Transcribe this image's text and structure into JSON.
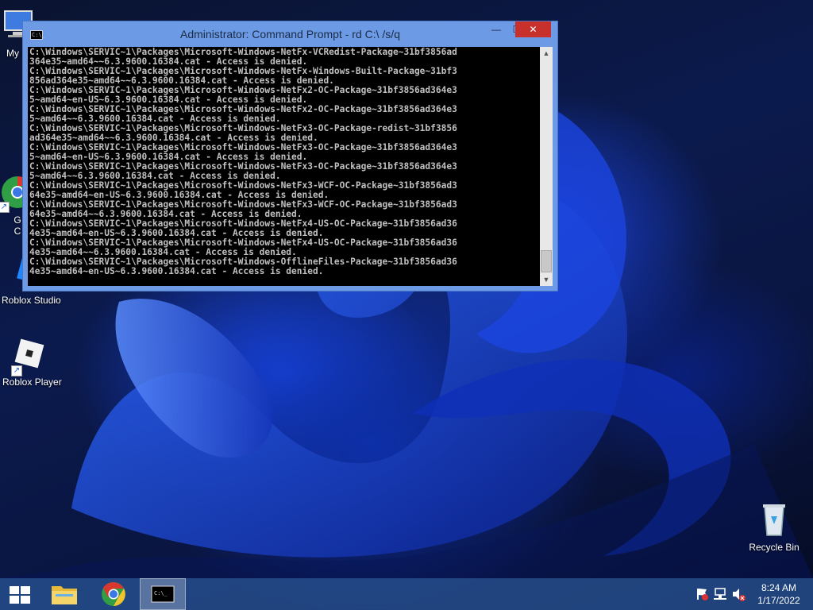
{
  "desktop": {
    "icons": [
      {
        "label": "My C"
      },
      {
        "label": "G"
      },
      {
        "label": "C"
      },
      {
        "label": "Roblox Studio"
      },
      {
        "label": "Roblox Player"
      },
      {
        "label": "Recycle Bin"
      }
    ]
  },
  "window": {
    "title": "Administrator: Command Prompt - rd  C:\\ /s/q",
    "icon": "cmd-icon",
    "controls": {
      "minimize": "—",
      "maximize": "☐",
      "close": "✕"
    },
    "console_output": "C:\\Windows\\SERVIC~1\\Packages\\Microsoft-Windows-NetFx-VCRedist-Package~31bf3856ad\n364e35~amd64~~6.3.9600.16384.cat - Access is denied.\nC:\\Windows\\SERVIC~1\\Packages\\Microsoft-Windows-NetFx-Windows-Built-Package~31bf3\n856ad364e35~amd64~~6.3.9600.16384.cat - Access is denied.\nC:\\Windows\\SERVIC~1\\Packages\\Microsoft-Windows-NetFx2-OC-Package~31bf3856ad364e3\n5~amd64~en-US~6.3.9600.16384.cat - Access is denied.\nC:\\Windows\\SERVIC~1\\Packages\\Microsoft-Windows-NetFx2-OC-Package~31bf3856ad364e3\n5~amd64~~6.3.9600.16384.cat - Access is denied.\nC:\\Windows\\SERVIC~1\\Packages\\Microsoft-Windows-NetFx3-OC-Package-redist~31bf3856\nad364e35~amd64~~6.3.9600.16384.cat - Access is denied.\nC:\\Windows\\SERVIC~1\\Packages\\Microsoft-Windows-NetFx3-OC-Package~31bf3856ad364e3\n5~amd64~en-US~6.3.9600.16384.cat - Access is denied.\nC:\\Windows\\SERVIC~1\\Packages\\Microsoft-Windows-NetFx3-OC-Package~31bf3856ad364e3\n5~amd64~~6.3.9600.16384.cat - Access is denied.\nC:\\Windows\\SERVIC~1\\Packages\\Microsoft-Windows-NetFx3-WCF-OC-Package~31bf3856ad3\n64e35~amd64~en-US~6.3.9600.16384.cat - Access is denied.\nC:\\Windows\\SERVIC~1\\Packages\\Microsoft-Windows-NetFx3-WCF-OC-Package~31bf3856ad3\n64e35~amd64~~6.3.9600.16384.cat - Access is denied.\nC:\\Windows\\SERVIC~1\\Packages\\Microsoft-Windows-NetFx4-US-OC-Package~31bf3856ad36\n4e35~amd64~en-US~6.3.9600.16384.cat - Access is denied.\nC:\\Windows\\SERVIC~1\\Packages\\Microsoft-Windows-NetFx4-US-OC-Package~31bf3856ad36\n4e35~amd64~~6.3.9600.16384.cat - Access is denied.\nC:\\Windows\\SERVIC~1\\Packages\\Microsoft-Windows-OfflineFiles-Package~31bf3856ad36\n4e35~amd64~en-US~6.3.9600.16384.cat - Access is denied."
  },
  "taskbar": {
    "items": [
      "start-button",
      "file-explorer",
      "google-chrome",
      "command-prompt"
    ],
    "clock": {
      "time": "8:24 AM",
      "date": "1/17/2022"
    },
    "tray_icons": [
      "action-center-flag-icon",
      "network-icon",
      "volume-muted-icon"
    ]
  },
  "colors": {
    "titlebar": "#6c9ae5",
    "close_button": "#c7302b",
    "console_bg": "#000000",
    "console_fg": "#c0c0c0",
    "taskbar": "#264e8c"
  }
}
